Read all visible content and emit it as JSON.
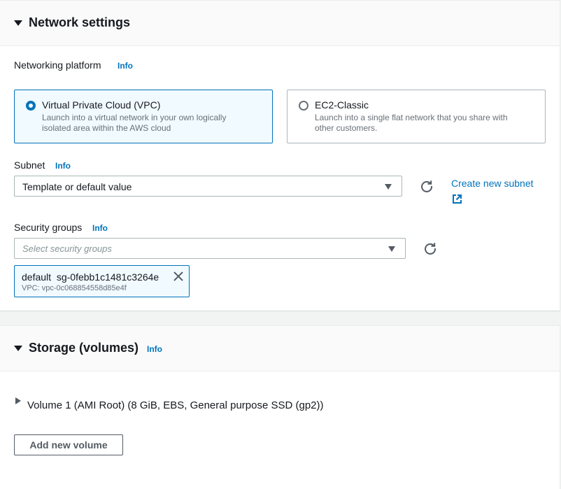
{
  "network": {
    "title": "Network settings",
    "platform_label": "Networking platform",
    "info": "Info",
    "options": [
      {
        "title": "Virtual Private Cloud (VPC)",
        "desc": "Launch into a virtual network in your own logically isolated area within the AWS cloud",
        "selected": true
      },
      {
        "title": "EC2-Classic",
        "desc": "Launch into a single flat network that you share with other customers.",
        "selected": false
      }
    ],
    "subnet": {
      "label": "Subnet",
      "value": "Template or default value",
      "create_link": "Create new subnet"
    },
    "security_groups": {
      "label": "Security groups",
      "placeholder": "Select security groups",
      "token": {
        "name": "default",
        "id": "sg-0febb1c1481c3264e",
        "vpc": "VPC: vpc-0c068854558d85e4f"
      }
    }
  },
  "storage": {
    "title": "Storage (volumes)",
    "info": "Info",
    "volume_label": "Volume 1 (AMI Root) (8 GiB, EBS, General purpose SSD (gp2))",
    "add_button": "Add new volume"
  },
  "colors": {
    "link": "#0073bb",
    "selected_bg": "#f1faff",
    "border": "#aab7b8"
  }
}
